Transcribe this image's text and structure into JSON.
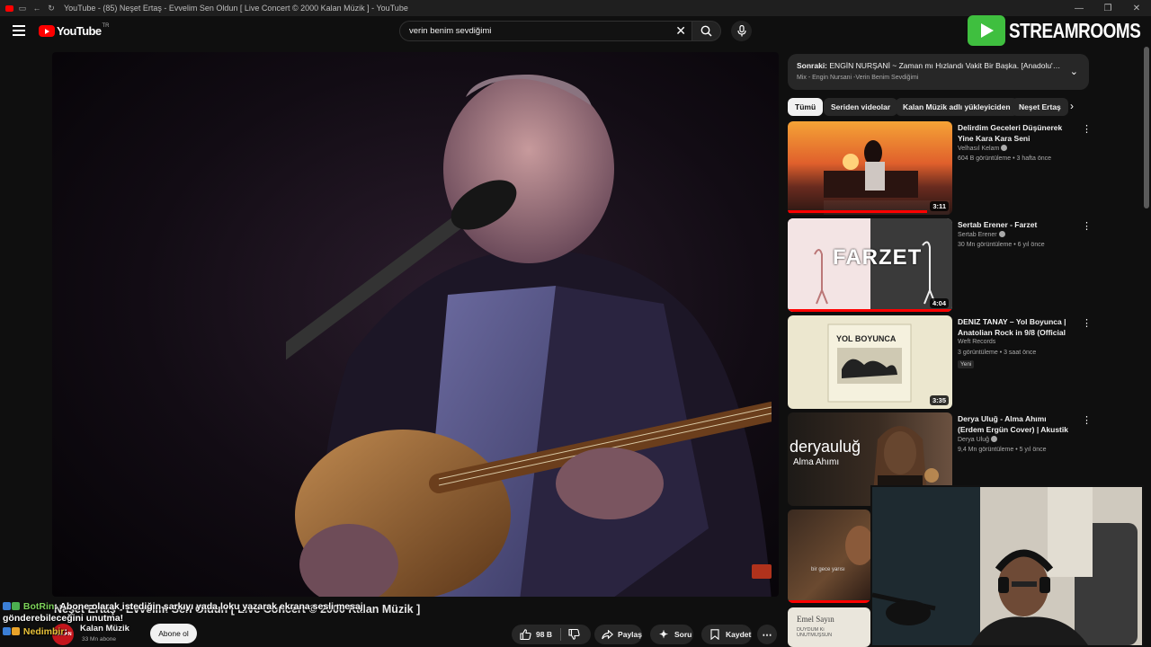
{
  "browser": {
    "tab_title": "YouTube - (85) Neşet Ertaş - Evvelim Sen Oldun [ Live Concert © 2000 Kalan Müzik ] - YouTube"
  },
  "masthead": {
    "logo_text": "YouTube",
    "country_code": "TR",
    "search_value": "verin benim sevdiğimi"
  },
  "overlay": {
    "brand_text": "STREAMROOMS"
  },
  "video": {
    "title": "Neşet Ertaş - Evvelim Sen Oldun [ Live Concert © 2000 Kalan Müzik ]",
    "channel_avatar_text": "KALAN",
    "channel_name": "Kalan Müzik",
    "subscribers": "33 Mn abone",
    "subscribe_label": "Abone ol",
    "likes": "98 B",
    "share_label": "Paylaş",
    "ask_label": "Soru",
    "save_label": "Kaydet"
  },
  "chat": [
    {
      "user": "BotRin",
      "message": "Abone olarak istediğin şarkıyı yada loku yazarak ekrana sesli mesaj gönderebileceğini unutma!"
    },
    {
      "user": "Nedimbir",
      "message": ""
    }
  ],
  "up_next": {
    "label": "Sonraki:",
    "title": "ENGİN NURŞANİ ~ Zaman mı Hızlandı Vakit Bir Başka. [Anadolu'nun Sesi]",
    "subtitle": "Mix - Engin Nursani -Verin Benim Sevdiğimi"
  },
  "chips": [
    "Tümü",
    "Seriden videolar",
    "Kalan Müzik adlı yükleyiciden",
    "Neşet Ertaş"
  ],
  "recommendations": [
    {
      "title": "Delirdim Geceleri Düşünerek Yine Kara Kara Seni",
      "channel": "Velhasıl Kelam",
      "verified": true,
      "meta": "604 B görüntüleme • 3 hafta önce",
      "duration": "3:11",
      "badge": ""
    },
    {
      "title": "Sertab Erener - Farzet",
      "channel": "Sertab Erener",
      "verified": true,
      "meta": "30 Mn görüntüleme • 6 yıl önce",
      "duration": "4:04",
      "badge": "",
      "thumb_text": "FARZET"
    },
    {
      "title": "DENIZ TANAY – Yol Boyunca | Anatolian Rock in 9/8 (Official ...",
      "channel": "Weft Records",
      "verified": false,
      "meta": "3 görüntüleme • 3 saat önce",
      "duration": "3:35",
      "badge": "Yeni",
      "thumb_text": "YOL BOYUNCA"
    },
    {
      "title": "Derya Uluğ - Alma Ahımı (Erdem Ergün Cover) | Akustik",
      "channel": "Derya Uluğ",
      "verified": true,
      "meta": "9,4 Mn görüntüleme • 5 yıl önce",
      "duration": "",
      "badge": "",
      "thumb_text": "deryauluğ",
      "thumb_sub": "Alma Ahımı"
    }
  ],
  "partial_thumbs": [
    {
      "caption": "bir gece yarısı"
    },
    {
      "caption": "Emel Sayın",
      "sub": "DUYDUM Ki UNUTMUŞSUN"
    }
  ]
}
